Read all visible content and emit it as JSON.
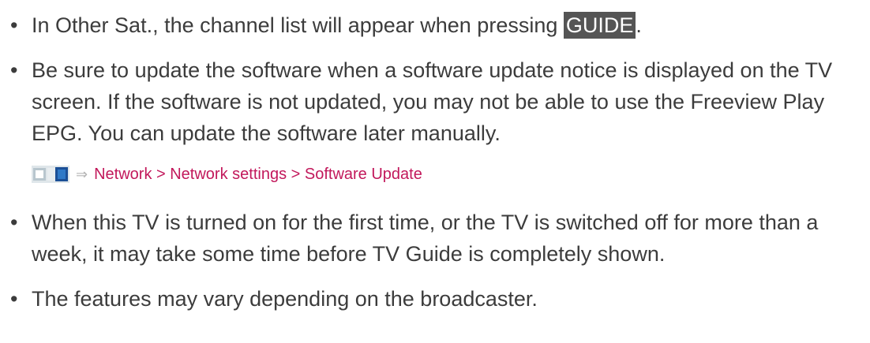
{
  "notes": [
    {
      "pre": "In Other Sat., the channel list will appear when pressing ",
      "key": "GUIDE",
      "post": "."
    },
    {
      "text": "Be sure to update the software when a software update notice is displayed on the TV screen. If the software is not updated, you may not be able to use the Freeview Play EPG. You can update the software later manually."
    },
    {
      "text": "When this TV is turned on for the first time, or the TV is switched off for more than a week, it may take some time before TV Guide is completely shown."
    },
    {
      "text": "The features may vary depending on the broadcaster."
    }
  ],
  "nav_path": {
    "arrow": "⇒",
    "text": "Network > Network settings > Software Update"
  },
  "icons": {
    "bullet": "•",
    "menu": "menu-icon"
  }
}
